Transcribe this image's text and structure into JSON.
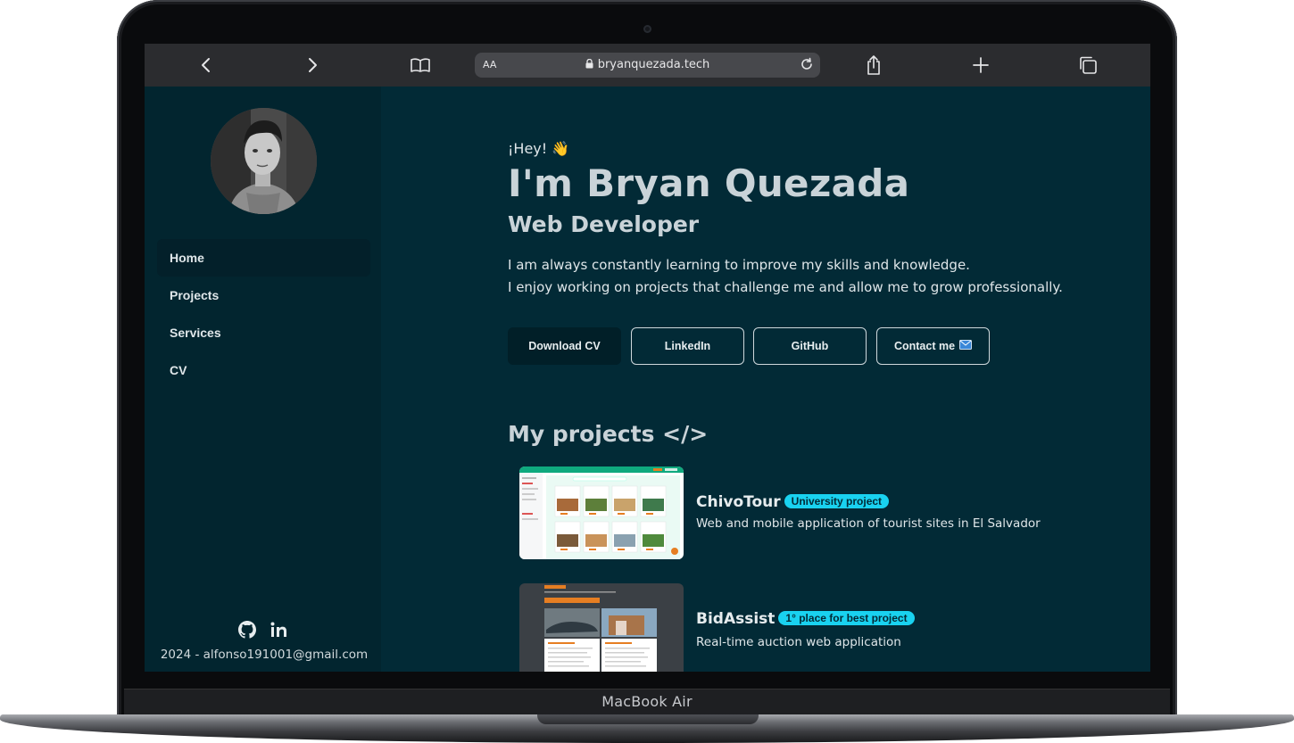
{
  "device": {
    "label": "MacBook Air"
  },
  "browser": {
    "url_prefix": "AA",
    "url": "bryanquezada.tech",
    "icons": [
      "back-icon",
      "forward-icon",
      "bookmarks-icon",
      "lock-icon",
      "reload-icon",
      "share-icon",
      "new-tab-icon",
      "tabs-icon"
    ]
  },
  "sidebar": {
    "nav": [
      {
        "label": "Home",
        "active": true
      },
      {
        "label": "Projects",
        "active": false
      },
      {
        "label": "Services",
        "active": false
      },
      {
        "label": "CV",
        "active": false
      }
    ],
    "social_icons": [
      "github-icon",
      "linkedin-icon"
    ],
    "footer": "2024 - alfonso191001@gmail.com"
  },
  "hero": {
    "greeting": "¡Hey! 👋",
    "name": "I'm Bryan Quezada",
    "role": "Web Developer",
    "bio_line1": "I am always constantly learning to improve my skills and knowledge.",
    "bio_line2": "I enjoy working on projects that challenge me and allow me to grow professionally.",
    "buttons": {
      "download_cv": "Download CV",
      "linkedin": "LinkedIn",
      "github": "GitHub",
      "contact": "Contact me"
    }
  },
  "projects": {
    "title": "My projects </>",
    "items": [
      {
        "name": "ChivoTour",
        "badge": "University project",
        "description": "Web and mobile application of tourist sites in El Salvador"
      },
      {
        "name": "BidAssist",
        "badge": "1° place for best project",
        "description": "Real-time auction web application"
      }
    ]
  },
  "colors": {
    "background": "#022a36",
    "sidebar": "#02252f",
    "badge": "#19d2f0"
  }
}
